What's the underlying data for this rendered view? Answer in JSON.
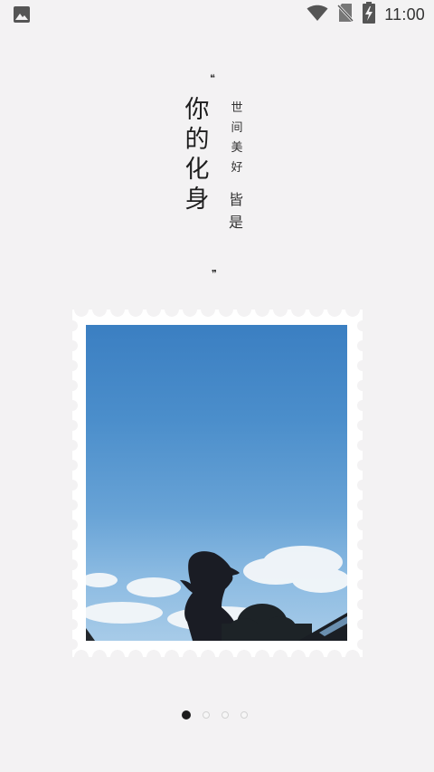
{
  "status_bar": {
    "time": "11:00",
    "icons": [
      "image-notification-icon",
      "wifi-icon",
      "no-sim-icon",
      "battery-charging-icon"
    ]
  },
  "poem": {
    "open_quote": "❝",
    "title_vertical": "你\n的\n化\n身",
    "line1_vertical": "世\n间\n美\n好",
    "line2_vertical": "皆\n是",
    "close_quote": "❞"
  },
  "photo": {
    "description_icon": "silhouette-photo"
  },
  "pager": {
    "total": 4,
    "active_index": 0
  }
}
